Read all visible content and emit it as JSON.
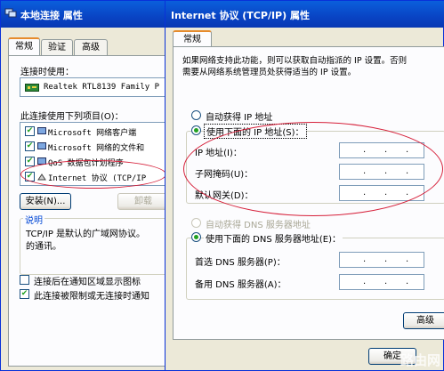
{
  "win1": {
    "title": "本地连接 属性",
    "tabs": [
      "常规",
      "验证",
      "高级"
    ],
    "connect_using_label": "连接时使用：",
    "adapter": "Realtek RTL8139 Family P",
    "items_label": "此连接使用下列项目(O)：",
    "items": [
      {
        "label": "Microsoft 网络客户端",
        "checked": true
      },
      {
        "label": "Microsoft 网络的文件和",
        "checked": true
      },
      {
        "label": "QoS 数据包计划程序",
        "checked": true
      },
      {
        "label": "Internet 协议 (TCP/IP",
        "checked": true
      }
    ],
    "install_button": "安装(N)...",
    "uninstall_button": "卸载",
    "description_title": "说明",
    "description_text": "TCP/IP 是默认的广域网协议。\n的通讯。",
    "show_icon_option": "连接后在通知区域显示图标",
    "notify_option": "此连接被限制或无连接时通知"
  },
  "win2": {
    "title": "Internet 协议 (TCP/IP) 属性",
    "tab": "常规",
    "intro_line1": "如果网络支持此功能，则可以获取自动指派的 IP 设置。否则",
    "intro_line2": "需要从网络系统管理员处获得适当的 IP 设置。",
    "auto_ip": "自动获得 IP 地址",
    "manual_ip": "使用下面的 IP 地址(S)：",
    "ip_label": "IP 地址(I)：",
    "mask_label": "子网掩码(U)：",
    "gateway_label": "默认网关(D)：",
    "auto_dns": "自动获得 DNS 服务器地址",
    "manual_dns": "使用下面的 DNS 服务器地址(E)：",
    "dns1_label": "首选 DNS 服务器(P)：",
    "dns2_label": "备用 DNS 服务器(A)：",
    "advanced_button": "高级",
    "ok_button": "确定",
    "dot": "."
  },
  "watermark": "路由网",
  "colors": {
    "titlebar": "#0a5fdc",
    "dialog": "#ece9d8",
    "annotation": "#d6203a",
    "check": "#21a121"
  }
}
